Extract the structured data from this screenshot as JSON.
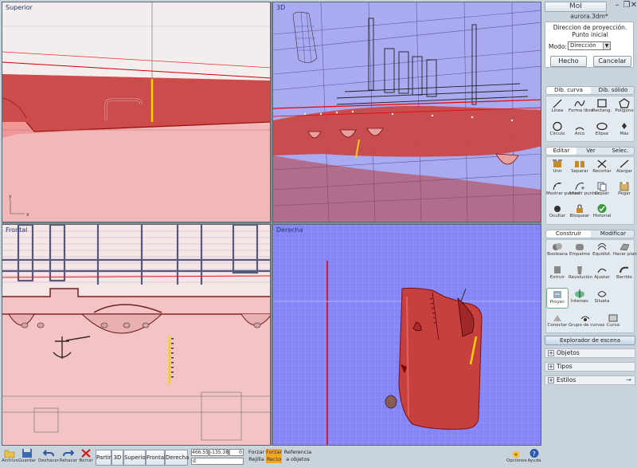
{
  "viewports": {
    "top": "Superior",
    "perspective": "3D",
    "front": "Frontal",
    "right": "Derecha",
    "axis_x": "x",
    "axis_y": "y"
  },
  "panel": {
    "app_name": "MoI",
    "filename": "aurora.3dm*",
    "command": {
      "title_line1": "Direccion de proyección.",
      "title_line2": "Punto inicial",
      "mode_label": "Modo:",
      "mode_value": "Dirección",
      "done": "Hecho",
      "cancel": "Cancelar"
    },
    "draw_tabs": [
      "Dib. curva",
      "Dib. sólido"
    ],
    "draw_tools": [
      "Línea",
      "Forma libre",
      "Rectang.",
      "Polígono",
      "Círculo",
      "Arco",
      "Elipse",
      "Más"
    ],
    "edit_tabs": [
      "Editar",
      "Ver",
      "Selec."
    ],
    "edit_tools": [
      "Unir",
      "Separar",
      "Recortar",
      "Alargar",
      "Mostrar puntos",
      "Añadir puntos",
      "Copiar",
      "Pegar",
      "Ocultar",
      "Bloquear",
      "Historial"
    ],
    "construct_tabs": [
      "Construir",
      "Modificar"
    ],
    "construct_tools": [
      "Booleana",
      "Empalme",
      "Equidist.",
      "Hacer plano",
      "Extruir",
      "Revolución",
      "Ajustar",
      "Barrido",
      "Proyec",
      "Intersec",
      "Silueta",
      "Conectar",
      "Grupo de curvas",
      "Curva"
    ],
    "explorer": {
      "title": "Explorador de escena",
      "items": [
        "Objetos",
        "Tipos",
        "Estilos"
      ]
    }
  },
  "bottom": {
    "file_buttons": [
      "Archivo",
      "Guardar",
      "Deshacer",
      "Rehacer",
      "Borrar"
    ],
    "view_buttons": [
      "Partir",
      "3D",
      "Superior",
      "Frontal",
      "Derecha"
    ],
    "coords": [
      "466.55",
      "-135.38",
      "0"
    ],
    "coord_extra": "d",
    "grid_label1": "Forzar",
    "grid_label2": "Rejilla",
    "straight_label1": "Forzar",
    "straight_label2": "Recto",
    "ref1": "Referencia",
    "ref2": "a objetos",
    "options": "Opciones",
    "help": "Ayuda"
  }
}
